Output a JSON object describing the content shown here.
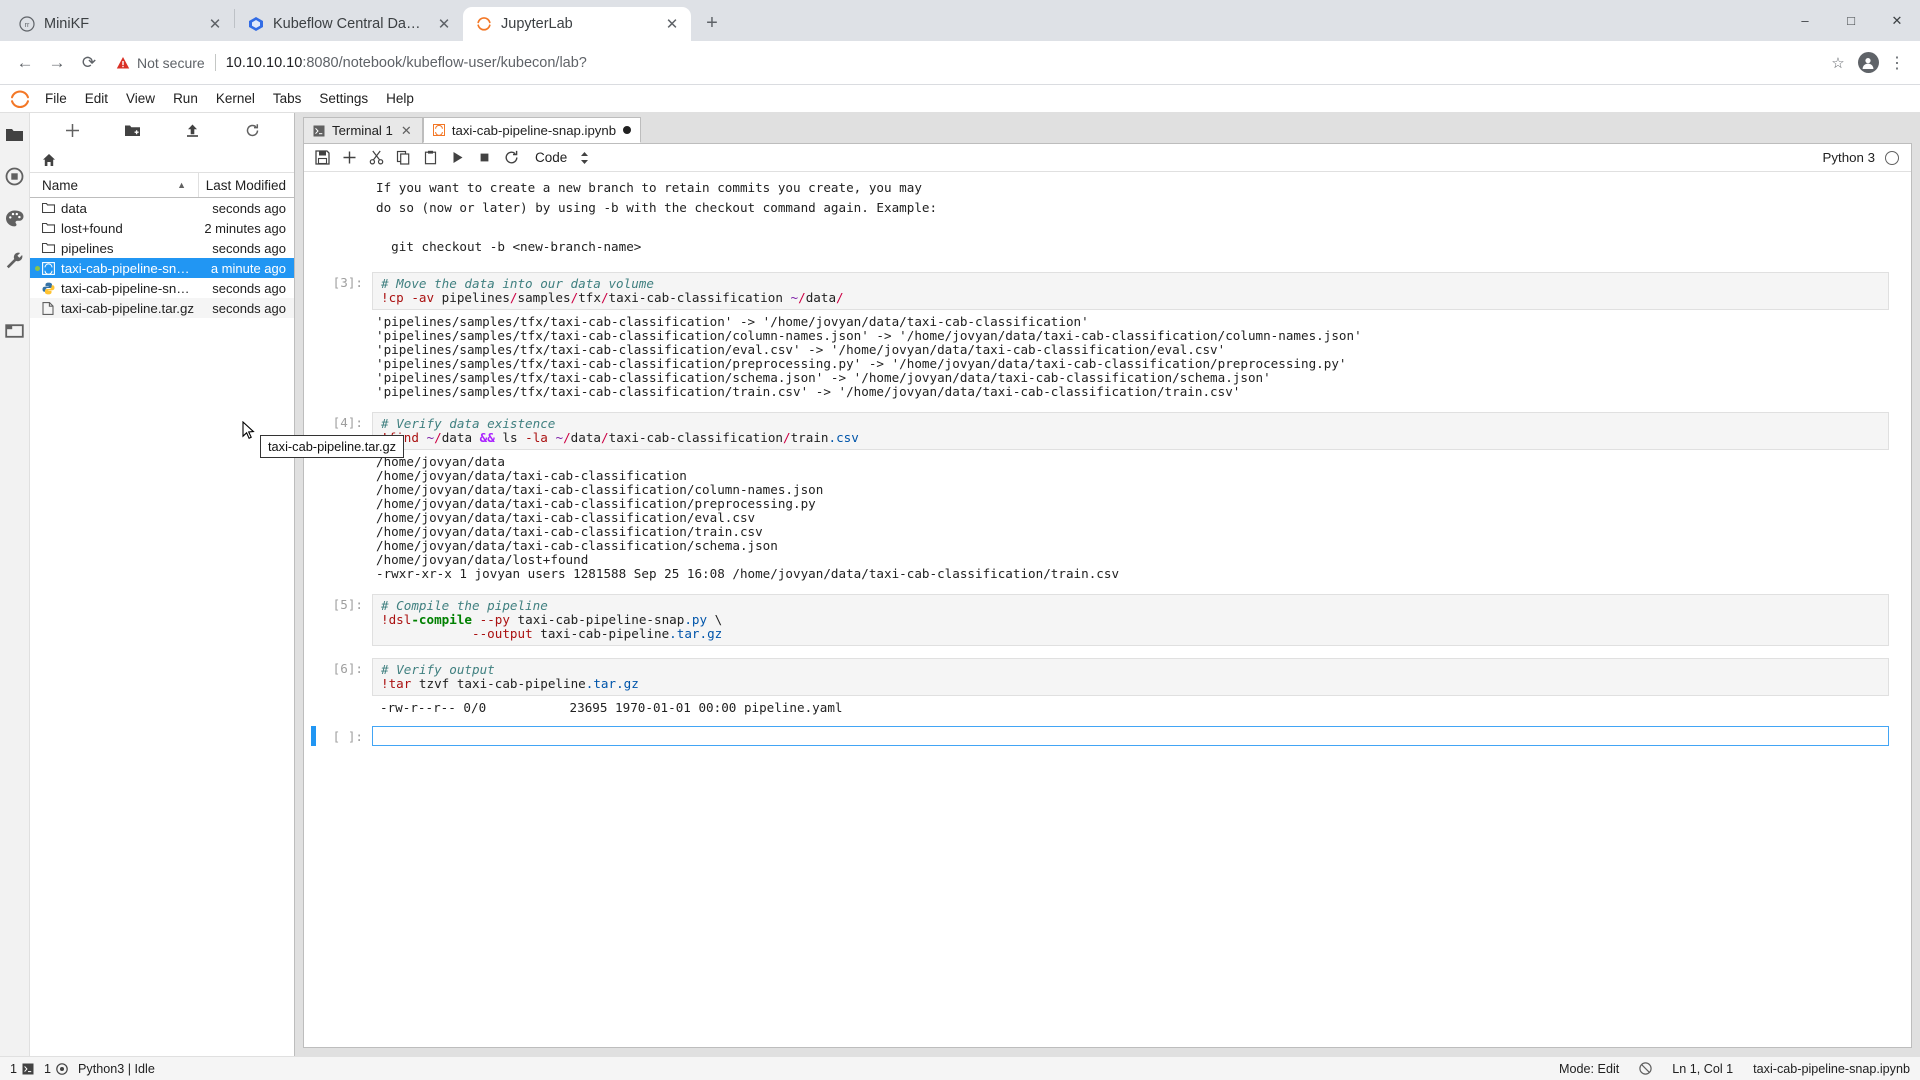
{
  "browser": {
    "tabs": [
      {
        "label": "MiniKF",
        "favicon": "rr-circle-icon",
        "active": false,
        "closeable": true
      },
      {
        "label": "Kubeflow Central Dashboard",
        "favicon": "kubeflow-icon",
        "active": false,
        "closeable": true
      },
      {
        "label": "JupyterLab",
        "favicon": "jupyter-icon",
        "active": true,
        "closeable": true
      }
    ],
    "new_tab_label": "+",
    "window_controls": {
      "minimize": "–",
      "maximize": "□",
      "close": "✕"
    },
    "nav": {
      "back": "←",
      "forward": "→",
      "reload": "⟳"
    },
    "security_label": "Not secure",
    "url_host": "10.10.10.10",
    "url_rest": ":8080/notebook/kubeflow-user/kubecon/lab?",
    "bookmark_icon": "☆",
    "menu_icon": "⋮"
  },
  "jupyter": {
    "menu": [
      "File",
      "Edit",
      "View",
      "Run",
      "Kernel",
      "Tabs",
      "Settings",
      "Help"
    ],
    "activity_bar": [
      {
        "name": "file-browser-icon",
        "active": true
      },
      {
        "name": "running-terminals-icon",
        "active": false
      },
      {
        "name": "palette-icon",
        "active": false
      },
      {
        "name": "tools-icon",
        "active": false
      },
      {
        "name": "tabs-icon",
        "active": false
      }
    ],
    "file_browser": {
      "toolbar": [
        {
          "name": "new-launcher-button",
          "glyph": "+"
        },
        {
          "name": "new-folder-button",
          "glyph": "folder-plus"
        },
        {
          "name": "upload-button",
          "glyph": "upload"
        },
        {
          "name": "refresh-button",
          "glyph": "refresh"
        }
      ],
      "breadcrumb_home": "home-icon",
      "columns": {
        "name": "Name",
        "last_modified": "Last Modified"
      },
      "sort_indicator": "▲",
      "items": [
        {
          "name": "data",
          "modified": "seconds ago",
          "type": "folder",
          "selected": false,
          "hovered": false,
          "dirty": false
        },
        {
          "name": "lost+found",
          "modified": "2 minutes ago",
          "type": "folder",
          "selected": false,
          "hovered": false,
          "dirty": false
        },
        {
          "name": "pipelines",
          "modified": "seconds ago",
          "type": "folder",
          "selected": false,
          "hovered": false,
          "dirty": false
        },
        {
          "name": "taxi-cab-pipeline-snap.ip...",
          "modified": "a minute ago",
          "type": "notebook",
          "selected": true,
          "hovered": false,
          "dirty": true
        },
        {
          "name": "taxi-cab-pipeline-snap.py",
          "modified": "seconds ago",
          "type": "python",
          "selected": false,
          "hovered": false,
          "dirty": false
        },
        {
          "name": "taxi-cab-pipeline.tar.gz",
          "modified": "seconds ago",
          "type": "file",
          "selected": false,
          "hovered": true,
          "dirty": false
        }
      ],
      "tooltip": "taxi-cab-pipeline.tar.gz"
    },
    "dock_tabs": [
      {
        "label": "Terminal 1",
        "icon": "terminal-icon",
        "active": false,
        "dirty": false,
        "close": "✕"
      },
      {
        "label": "taxi-cab-pipeline-snap.ipynb",
        "icon": "notebook-icon",
        "active": true,
        "dirty": true,
        "close": "✕"
      }
    ],
    "notebook_toolbar": {
      "buttons": [
        {
          "name": "save-button",
          "glyph": "save"
        },
        {
          "name": "insert-cell-button",
          "glyph": "+"
        },
        {
          "name": "cut-cell-button",
          "glyph": "scissors"
        },
        {
          "name": "copy-cell-button",
          "glyph": "copy"
        },
        {
          "name": "paste-cell-button",
          "glyph": "paste"
        },
        {
          "name": "run-cell-button",
          "glyph": "play"
        },
        {
          "name": "interrupt-kernel-button",
          "glyph": "stop"
        },
        {
          "name": "restart-kernel-button",
          "glyph": "restart"
        }
      ],
      "cell_type": "Code",
      "cell_type_chevron": "↕",
      "kernel_name": "Python 3",
      "kernel_status": "idle"
    },
    "cells": [
      {
        "kind": "scrolled-output",
        "prompt": "",
        "lines": [
          "",
          "If you want to create a new branch to retain commits you create, you may",
          "do so (now or later) by using -b with the checkout command again. Example:",
          "",
          "  git checkout -b <new-branch-name>",
          ""
        ]
      },
      {
        "kind": "code",
        "prompt": "[3]:",
        "source_comment": "# Move the data into our data volume",
        "source_code": "!cp -av pipelines/samples/tfx/taxi-cab-classification ~/data/",
        "output": [
          "'pipelines/samples/tfx/taxi-cab-classification' -> '/home/jovyan/data/taxi-cab-classification'",
          "'pipelines/samples/tfx/taxi-cab-classification/column-names.json' -> '/home/jovyan/data/taxi-cab-classification/column-names.json'",
          "'pipelines/samples/tfx/taxi-cab-classification/eval.csv' -> '/home/jovyan/data/taxi-cab-classification/eval.csv'",
          "'pipelines/samples/tfx/taxi-cab-classification/preprocessing.py' -> '/home/jovyan/data/taxi-cab-classification/preprocessing.py'",
          "'pipelines/samples/tfx/taxi-cab-classification/schema.json' -> '/home/jovyan/data/taxi-cab-classification/schema.json'",
          "'pipelines/samples/tfx/taxi-cab-classification/train.csv' -> '/home/jovyan/data/taxi-cab-classification/train.csv'"
        ]
      },
      {
        "kind": "code",
        "prompt": "[4]:",
        "source_comment": "# Verify data existence",
        "source_code": "!find ~/data && ls -la ~/data/taxi-cab-classification/train.csv",
        "output": [
          "/home/jovyan/data",
          "/home/jovyan/data/taxi-cab-classification",
          "/home/jovyan/data/taxi-cab-classification/column-names.json",
          "/home/jovyan/data/taxi-cab-classification/preprocessing.py",
          "/home/jovyan/data/taxi-cab-classification/eval.csv",
          "/home/jovyan/data/taxi-cab-classification/train.csv",
          "/home/jovyan/data/taxi-cab-classification/schema.json",
          "/home/jovyan/data/lost+found",
          "-rwxr-xr-x 1 jovyan users 1281588 Sep 25 16:08 /home/jovyan/data/taxi-cab-classification/train.csv"
        ]
      },
      {
        "kind": "code",
        "prompt": "[5]:",
        "source_comment": "# Compile the pipeline",
        "source_code": "!dsl-compile --py taxi-cab-pipeline-snap.py \\\n            --output taxi-cab-pipeline.tar.gz",
        "output": []
      },
      {
        "kind": "code",
        "prompt": "[6]:",
        "source_comment": "# Verify output",
        "source_code": "!tar tzvf taxi-cab-pipeline.tar.gz",
        "output": [
          "-rw-r--r-- 0/0           23695 1970-01-01 00:00 pipeline.yaml"
        ]
      },
      {
        "kind": "empty",
        "prompt": "[ ]:",
        "source_comment": "",
        "source_code": "",
        "output": []
      }
    ],
    "status_bar": {
      "terminal_count": "1",
      "kernel_count": "1",
      "kernel_label": "Python3 | Idle",
      "mode": "Mode: Edit",
      "cursor": "Ln 1, Col 1",
      "filename": "taxi-cab-pipeline-snap.ipynb"
    }
  },
  "colors": {
    "accent_blue": "#2196f3",
    "jupyter_orange": "#f37726",
    "warning_red": "#d93025",
    "comment_teal": "#408080",
    "string_red": "#aa1111",
    "keyword_green": "#008000"
  }
}
